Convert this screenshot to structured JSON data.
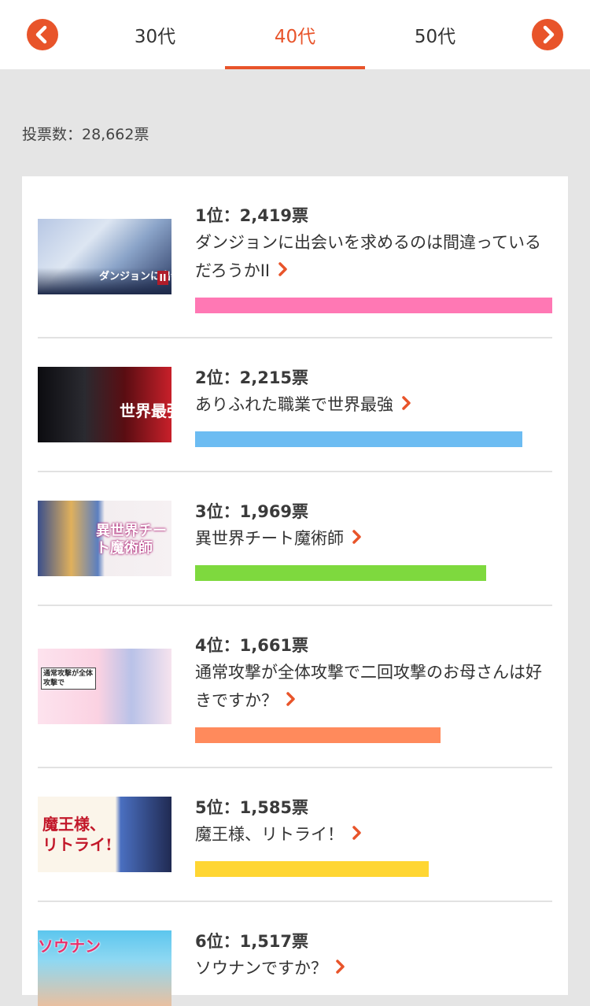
{
  "nav": {
    "prev_icon": "chevron-left-icon",
    "next_icon": "chevron-right-icon",
    "tabs": [
      "30代",
      "40代",
      "50代"
    ],
    "active_tab": "40代"
  },
  "summary": {
    "vote_total_label": "投票数：28,662票"
  },
  "colors": {
    "accent": "#e8542a",
    "divider": "#e2e2e2",
    "background": "#e5e5e5"
  },
  "ranking": [
    {
      "rank_label": "1位：2,419票",
      "title": "ダンジョンに出会いを求めるのは間違っているだろうかII",
      "votes": 2419,
      "bar_color": "#ff78b4",
      "thumb_caption": "ダンジョンに出会い"
    },
    {
      "rank_label": "2位：2,215票",
      "title": "ありふれた職業で世界最強",
      "votes": 2215,
      "bar_color": "#6cbcf2",
      "thumb_caption": "世界最強"
    },
    {
      "rank_label": "3位：1,969票",
      "title": "異世界チート魔術師",
      "votes": 1969,
      "bar_color": "#7ed93e",
      "thumb_caption": "異世界チート魔術師"
    },
    {
      "rank_label": "4位：1,661票",
      "title": "通常攻撃が全体攻撃で二回攻撃のお母さんは好きですか？",
      "votes": 1661,
      "bar_color": "#ff8a5c",
      "thumb_caption": "通常攻撃が全体攻撃で"
    },
    {
      "rank_label": "5位：1,585票",
      "title": "魔王様、リトライ！",
      "votes": 1585,
      "bar_color": "#ffd633",
      "thumb_caption": "魔王様、リトライ!"
    },
    {
      "rank_label": "6位：1,517票",
      "title": "ソウナンですか？",
      "votes": 1517,
      "bar_color": "#f2c200",
      "thumb_caption": "ソウナン"
    }
  ]
}
